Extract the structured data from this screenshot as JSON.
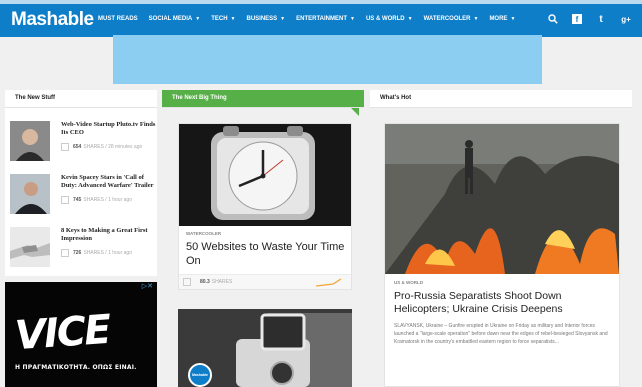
{
  "brand": {
    "name": "Mashable",
    "nav_color": "#0f7ec9",
    "accent_green": "#57b047"
  },
  "nav": {
    "items": [
      {
        "label": "MUST READS",
        "has_dropdown": false
      },
      {
        "label": "SOCIAL MEDIA",
        "has_dropdown": true
      },
      {
        "label": "TECH",
        "has_dropdown": true
      },
      {
        "label": "BUSINESS",
        "has_dropdown": true
      },
      {
        "label": "ENTERTAINMENT",
        "has_dropdown": true
      },
      {
        "label": "US & WORLD",
        "has_dropdown": true
      },
      {
        "label": "WATERCOOLER",
        "has_dropdown": true
      },
      {
        "label": "MORE",
        "has_dropdown": true
      }
    ],
    "caret": "▼",
    "icons": [
      "search-icon",
      "facebook-icon",
      "twitter-icon",
      "google-plus-icon"
    ],
    "icon_glyphs": {
      "search": "⌕",
      "facebook": "f",
      "twitter": "t",
      "google_plus": "g+"
    }
  },
  "columns": {
    "new_stuff": "The New Stuff",
    "next_big_thing": "The Next Big Thing",
    "whats_hot": "What's Hot"
  },
  "new_stuff": [
    {
      "title": "Web-Video Startup Pluto.tv Finds Its CEO",
      "shares": "654",
      "meta": "SHARES / 28 minutes ago"
    },
    {
      "title": "Kevin Spacey Stars in 'Call of Duty: Advanced Warfare' Trailer",
      "shares": "745",
      "meta": "SHARES / 1 hour ago"
    },
    {
      "title": "8 Keys to Making a Great First Impression",
      "shares": "726",
      "meta": "SHARES / 1 hour ago"
    }
  ],
  "ad": {
    "brand": "VICE",
    "tagline": "Η ΠΡΑΓΜΑΤΙΚΟΤΗΤΑ. ΟΠΩΣ ΕΙΝΑΙ.",
    "close": "▷✕"
  },
  "next_big_thing": {
    "tag": "WATERCOOLER",
    "title": "50 Websites to Waste Your Time On",
    "shares": "80.3",
    "shares_label": "SHARES",
    "badge": "Mashable"
  },
  "whats_hot": {
    "tag": "US & WORLD",
    "title": "Pro-Russia Separatists Shoot Down Helicopters; Ukraine Crisis Deepens",
    "excerpt": "SLAVYANSK, Ukraine – Gunfire erupted in Ukraine on Friday as military and Interior forces launched a \"large-scale operation\" before dawn near the edges of rebel-besieged Slovyansk and Kramatorsk in the country's embattled eastern region to force separatists..."
  }
}
